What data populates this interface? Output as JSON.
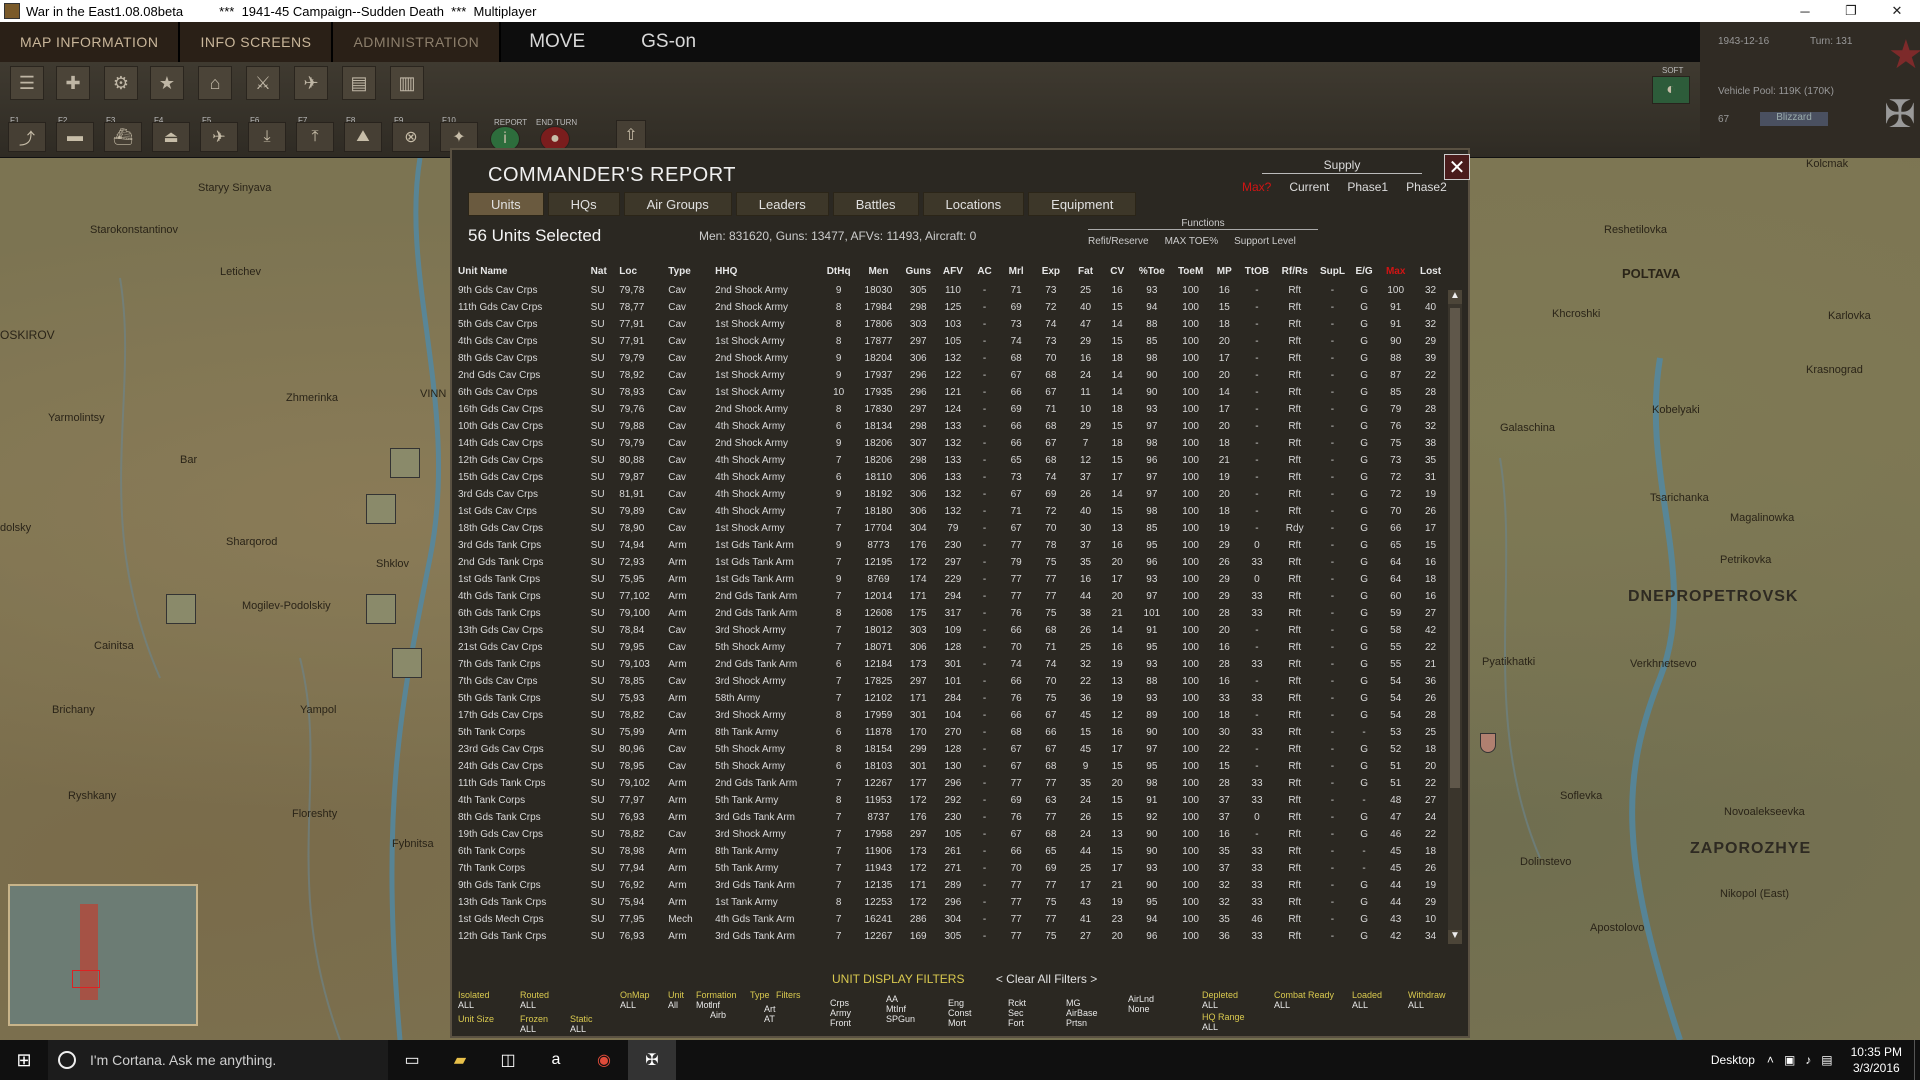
{
  "window": {
    "title": "War in the East1.08.08beta          ***  1941-45 Campaign--Sudden Death  ***  Multiplayer",
    "min": "─",
    "restore": "❐",
    "close": "✕"
  },
  "menubar": {
    "tabs": [
      "MAP INFORMATION",
      "INFO SCREENS",
      "ADMINISTRATION"
    ],
    "mode": "MOVE",
    "gs": "GS-on"
  },
  "toolbar": {
    "fkeys": [
      "F1",
      "F2",
      "F3",
      "F4",
      "F5",
      "F6",
      "F7",
      "F8",
      "F9",
      "F10"
    ],
    "report_label": "REPORT",
    "end_turn_label": "END TURN"
  },
  "infopanel": {
    "date": "1943-12-16",
    "turn": "Turn: 131",
    "vehicle_pool": "Vehicle Pool: 119K (170K)",
    "value67": "67",
    "weather": "Blizzard",
    "soft": "SOFT"
  },
  "map": {
    "towns": [
      {
        "name": "Staryy Sinyava"
      },
      {
        "name": "Starokonstantinov"
      },
      {
        "name": "Letichev"
      },
      {
        "name": "Zhmerinka"
      },
      {
        "name": "Yarmolintsy"
      },
      {
        "name": "Bar"
      },
      {
        "name": "Sharqorod"
      },
      {
        "name": "Shklov"
      },
      {
        "name": "Mogilev-Podolskiy"
      },
      {
        "name": "Cainitsa"
      },
      {
        "name": "Brichany"
      },
      {
        "name": "Yampol"
      },
      {
        "name": "Ryshkany"
      },
      {
        "name": "Floreshty"
      },
      {
        "name": "Fybnitsa"
      },
      {
        "name": "OSKIROV"
      },
      {
        "name": "dolsky"
      },
      {
        "name": "VINN"
      },
      {
        "name": "Kolcmak"
      },
      {
        "name": "Reshetilovka"
      },
      {
        "name": "POLTAVA"
      },
      {
        "name": "Khcroshki"
      },
      {
        "name": "Karlovka"
      },
      {
        "name": "Krasnograd"
      },
      {
        "name": "Kobelyaki"
      },
      {
        "name": "Galaschina"
      },
      {
        "name": "Tsarichanka"
      },
      {
        "name": "Magalinowka"
      },
      {
        "name": "Petrikovka"
      },
      {
        "name": "Pyatikhatki"
      },
      {
        "name": "Verkhnetsevo"
      },
      {
        "name": "Soflevka"
      },
      {
        "name": "Novoalekseevka"
      },
      {
        "name": "Dolinstevo"
      },
      {
        "name": "Nikopol (East)"
      },
      {
        "name": "Apostolovo"
      }
    ],
    "cities": [
      "DNEPROPETROVSK",
      "ZAPOROZHYE"
    ]
  },
  "report": {
    "title": "COMMANDER'S REPORT",
    "close": "✕",
    "supply": {
      "title": "Supply",
      "options": [
        "Max?",
        "Current",
        "Phase1",
        "Phase2"
      ]
    },
    "tabs": [
      "Units",
      "HQs",
      "Air Groups",
      "Leaders",
      "Battles",
      "Locations",
      "Equipment"
    ],
    "selected": "56 Units Selected",
    "summary": "Men: 831620, Guns: 13477, AFVs: 11493, Aircraft: 0",
    "functions": {
      "title": "Functions",
      "items": [
        "Refit/Reserve",
        "MAX TOE%",
        "Support Level"
      ]
    },
    "columns": [
      "Unit Name",
      "Nat",
      "Loc",
      "Type",
      "HHQ",
      "DtHq",
      "Men",
      "Guns",
      "AFV",
      "AC",
      "Mrl",
      "Exp",
      "Fat",
      "CV",
      "%Toe",
      "ToeM",
      "MP",
      "TtOB",
      "Rf/Rs",
      "SupL",
      "E/G",
      "Max",
      "Lost"
    ],
    "rows": [
      [
        "9th Gds Cav Crps",
        "SU",
        "79,78",
        "Cav",
        "2nd Shock Army",
        "9",
        "18030",
        "305",
        "110",
        "-",
        "71",
        "73",
        "25",
        "16",
        "93",
        "100",
        "16",
        "-",
        "Rft",
        "-",
        "G",
        "100",
        "32"
      ],
      [
        "11th Gds Cav Crps",
        "SU",
        "78,77",
        "Cav",
        "2nd Shock Army",
        "8",
        "17984",
        "298",
        "125",
        "-",
        "69",
        "72",
        "40",
        "15",
        "94",
        "100",
        "15",
        "-",
        "Rft",
        "-",
        "G",
        "91",
        "40"
      ],
      [
        "5th Gds Cav Crps",
        "SU",
        "77,91",
        "Cav",
        "1st Shock Army",
        "8",
        "17806",
        "303",
        "103",
        "-",
        "73",
        "74",
        "47",
        "14",
        "88",
        "100",
        "18",
        "-",
        "Rft",
        "-",
        "G",
        "91",
        "32"
      ],
      [
        "4th Gds Cav Crps",
        "SU",
        "77,91",
        "Cav",
        "1st Shock Army",
        "8",
        "17877",
        "297",
        "105",
        "-",
        "74",
        "73",
        "29",
        "15",
        "85",
        "100",
        "20",
        "-",
        "Rft",
        "-",
        "G",
        "90",
        "29"
      ],
      [
        "8th Gds Cav Crps",
        "SU",
        "79,79",
        "Cav",
        "2nd Shock Army",
        "9",
        "18204",
        "306",
        "132",
        "-",
        "68",
        "70",
        "16",
        "18",
        "98",
        "100",
        "17",
        "-",
        "Rft",
        "-",
        "G",
        "88",
        "39"
      ],
      [
        "2nd Gds Cav Crps",
        "SU",
        "78,92",
        "Cav",
        "1st Shock Army",
        "9",
        "17937",
        "296",
        "122",
        "-",
        "67",
        "68",
        "24",
        "14",
        "90",
        "100",
        "20",
        "-",
        "Rft",
        "-",
        "G",
        "87",
        "22"
      ],
      [
        "6th Gds Cav Crps",
        "SU",
        "78,93",
        "Cav",
        "1st Shock Army",
        "10",
        "17935",
        "296",
        "121",
        "-",
        "66",
        "67",
        "11",
        "14",
        "90",
        "100",
        "14",
        "-",
        "Rft",
        "-",
        "G",
        "85",
        "28"
      ],
      [
        "16th Gds Cav Crps",
        "SU",
        "79,76",
        "Cav",
        "2nd Shock Army",
        "8",
        "17830",
        "297",
        "124",
        "-",
        "69",
        "71",
        "10",
        "18",
        "93",
        "100",
        "17",
        "-",
        "Rft",
        "-",
        "G",
        "79",
        "28"
      ],
      [
        "10th Gds Cav Crps",
        "SU",
        "79,88",
        "Cav",
        "4th Shock Army",
        "6",
        "18134",
        "298",
        "133",
        "-",
        "66",
        "68",
        "29",
        "15",
        "97",
        "100",
        "20",
        "-",
        "Rft",
        "-",
        "G",
        "76",
        "32"
      ],
      [
        "14th Gds Cav Crps",
        "SU",
        "79,79",
        "Cav",
        "2nd Shock Army",
        "9",
        "18206",
        "307",
        "132",
        "-",
        "66",
        "67",
        "7",
        "18",
        "98",
        "100",
        "18",
        "-",
        "Rft",
        "-",
        "G",
        "75",
        "38"
      ],
      [
        "12th Gds Cav Crps",
        "SU",
        "80,88",
        "Cav",
        "4th Shock Army",
        "7",
        "18206",
        "298",
        "133",
        "-",
        "65",
        "68",
        "12",
        "15",
        "96",
        "100",
        "21",
        "-",
        "Rft",
        "-",
        "G",
        "73",
        "35"
      ],
      [
        "15th Gds Cav Crps",
        "SU",
        "79,87",
        "Cav",
        "4th Shock Army",
        "6",
        "18110",
        "306",
        "133",
        "-",
        "73",
        "74",
        "37",
        "17",
        "97",
        "100",
        "19",
        "-",
        "Rft",
        "-",
        "G",
        "72",
        "31"
      ],
      [
        "3rd Gds Cav Crps",
        "SU",
        "81,91",
        "Cav",
        "4th Shock Army",
        "9",
        "18192",
        "306",
        "132",
        "-",
        "67",
        "69",
        "26",
        "14",
        "97",
        "100",
        "20",
        "-",
        "Rft",
        "-",
        "G",
        "72",
        "19"
      ],
      [
        "1st Gds Cav Crps",
        "SU",
        "79,89",
        "Cav",
        "4th Shock Army",
        "7",
        "18180",
        "306",
        "132",
        "-",
        "71",
        "72",
        "40",
        "15",
        "98",
        "100",
        "18",
        "-",
        "Rft",
        "-",
        "G",
        "70",
        "26"
      ],
      [
        "18th Gds Cav Crps",
        "SU",
        "78,90",
        "Cav",
        "1st Shock Army",
        "7",
        "17704",
        "304",
        "79",
        "-",
        "67",
        "70",
        "30",
        "13",
        "85",
        "100",
        "19",
        "-",
        "Rdy",
        "-",
        "G",
        "66",
        "17"
      ],
      [
        "3rd Gds Tank Crps",
        "SU",
        "74,94",
        "Arm",
        "1st Gds Tank Arm",
        "9",
        "8773",
        "176",
        "230",
        "-",
        "77",
        "78",
        "37",
        "16",
        "95",
        "100",
        "29",
        "0",
        "Rft",
        "-",
        "G",
        "65",
        "15"
      ],
      [
        "2nd Gds Tank Crps",
        "SU",
        "72,93",
        "Arm",
        "1st Gds Tank Arm",
        "7",
        "12195",
        "172",
        "297",
        "-",
        "79",
        "75",
        "35",
        "20",
        "96",
        "100",
        "26",
        "33",
        "Rft",
        "-",
        "G",
        "64",
        "16"
      ],
      [
        "1st Gds Tank Crps",
        "SU",
        "75,95",
        "Arm",
        "1st Gds Tank Arm",
        "9",
        "8769",
        "174",
        "229",
        "-",
        "77",
        "77",
        "16",
        "17",
        "93",
        "100",
        "29",
        "0",
        "Rft",
        "-",
        "G",
        "64",
        "18"
      ],
      [
        "4th Gds Tank Crps",
        "SU",
        "77,102",
        "Arm",
        "2nd Gds Tank Arm",
        "7",
        "12014",
        "171",
        "294",
        "-",
        "77",
        "77",
        "44",
        "20",
        "97",
        "100",
        "29",
        "33",
        "Rft",
        "-",
        "G",
        "60",
        "16"
      ],
      [
        "6th Gds Tank Crps",
        "SU",
        "79,100",
        "Arm",
        "2nd Gds Tank Arm",
        "8",
        "12608",
        "175",
        "317",
        "-",
        "76",
        "75",
        "38",
        "21",
        "101",
        "100",
        "28",
        "33",
        "Rft",
        "-",
        "G",
        "59",
        "27"
      ],
      [
        "13th Gds Cav Crps",
        "SU",
        "78,84",
        "Cav",
        "3rd Shock Army",
        "7",
        "18012",
        "303",
        "109",
        "-",
        "66",
        "68",
        "26",
        "14",
        "91",
        "100",
        "20",
        "-",
        "Rft",
        "-",
        "G",
        "58",
        "42"
      ],
      [
        "21st Gds Cav Crps",
        "SU",
        "79,95",
        "Cav",
        "5th Shock Army",
        "7",
        "18071",
        "306",
        "128",
        "-",
        "70",
        "71",
        "25",
        "16",
        "95",
        "100",
        "16",
        "-",
        "Rft",
        "-",
        "G",
        "55",
        "22"
      ],
      [
        "7th Gds Tank Crps",
        "SU",
        "79,103",
        "Arm",
        "2nd Gds Tank Arm",
        "6",
        "12184",
        "173",
        "301",
        "-",
        "74",
        "74",
        "32",
        "19",
        "93",
        "100",
        "28",
        "33",
        "Rft",
        "-",
        "G",
        "55",
        "21"
      ],
      [
        "7th Gds Cav Crps",
        "SU",
        "78,85",
        "Cav",
        "3rd Shock Army",
        "7",
        "17825",
        "297",
        "101",
        "-",
        "66",
        "70",
        "22",
        "13",
        "88",
        "100",
        "16",
        "-",
        "Rft",
        "-",
        "G",
        "54",
        "36"
      ],
      [
        "5th Gds Tank Crps",
        "SU",
        "75,93",
        "Arm",
        "58th Army",
        "7",
        "12102",
        "171",
        "284",
        "-",
        "76",
        "75",
        "36",
        "19",
        "93",
        "100",
        "33",
        "33",
        "Rft",
        "-",
        "G",
        "54",
        "26"
      ],
      [
        "17th Gds Cav Crps",
        "SU",
        "78,82",
        "Cav",
        "3rd Shock Army",
        "8",
        "17959",
        "301",
        "104",
        "-",
        "66",
        "67",
        "45",
        "12",
        "89",
        "100",
        "18",
        "-",
        "Rft",
        "-",
        "G",
        "54",
        "28"
      ],
      [
        "5th Tank Corps",
        "SU",
        "75,99",
        "Arm",
        "8th Tank Army",
        "6",
        "11878",
        "170",
        "270",
        "-",
        "68",
        "66",
        "15",
        "16",
        "90",
        "100",
        "30",
        "33",
        "Rft",
        "-",
        "-",
        "53",
        "25"
      ],
      [
        "23rd Gds Cav Crps",
        "SU",
        "80,96",
        "Cav",
        "5th Shock Army",
        "8",
        "18154",
        "299",
        "128",
        "-",
        "67",
        "67",
        "45",
        "17",
        "97",
        "100",
        "22",
        "-",
        "Rft",
        "-",
        "G",
        "52",
        "18"
      ],
      [
        "24th Gds Cav Crps",
        "SU",
        "78,95",
        "Cav",
        "5th Shock Army",
        "6",
        "18103",
        "301",
        "130",
        "-",
        "67",
        "68",
        "9",
        "15",
        "95",
        "100",
        "15",
        "-",
        "Rft",
        "-",
        "G",
        "51",
        "20"
      ],
      [
        "11th Gds Tank Crps",
        "SU",
        "79,102",
        "Arm",
        "2nd Gds Tank Arm",
        "7",
        "12267",
        "177",
        "296",
        "-",
        "77",
        "77",
        "35",
        "20",
        "98",
        "100",
        "28",
        "33",
        "Rft",
        "-",
        "G",
        "51",
        "22"
      ],
      [
        "4th Tank Corps",
        "SU",
        "77,97",
        "Arm",
        "5th Tank Army",
        "8",
        "11953",
        "172",
        "292",
        "-",
        "69",
        "63",
        "24",
        "15",
        "91",
        "100",
        "37",
        "33",
        "Rft",
        "-",
        "-",
        "48",
        "27"
      ],
      [
        "8th Gds Tank Crps",
        "SU",
        "76,93",
        "Arm",
        "3rd Gds Tank Arm",
        "7",
        "8737",
        "176",
        "230",
        "-",
        "76",
        "77",
        "26",
        "15",
        "92",
        "100",
        "37",
        "0",
        "Rft",
        "-",
        "G",
        "47",
        "24"
      ],
      [
        "19th Gds Cav Crps",
        "SU",
        "78,82",
        "Cav",
        "3rd Shock Army",
        "7",
        "17958",
        "297",
        "105",
        "-",
        "67",
        "68",
        "24",
        "13",
        "90",
        "100",
        "16",
        "-",
        "Rft",
        "-",
        "G",
        "46",
        "22"
      ],
      [
        "6th Tank Corps",
        "SU",
        "78,98",
        "Arm",
        "8th Tank Army",
        "7",
        "11906",
        "173",
        "261",
        "-",
        "66",
        "65",
        "44",
        "15",
        "90",
        "100",
        "35",
        "33",
        "Rft",
        "-",
        "-",
        "45",
        "18"
      ],
      [
        "7th Tank Corps",
        "SU",
        "77,94",
        "Arm",
        "5th Tank Army",
        "7",
        "11943",
        "172",
        "271",
        "-",
        "70",
        "69",
        "25",
        "17",
        "93",
        "100",
        "37",
        "33",
        "Rft",
        "-",
        "-",
        "45",
        "26"
      ],
      [
        "9th Gds Tank Crps",
        "SU",
        "76,92",
        "Arm",
        "3rd Gds Tank Arm",
        "7",
        "12135",
        "171",
        "289",
        "-",
        "77",
        "77",
        "17",
        "21",
        "90",
        "100",
        "32",
        "33",
        "Rft",
        "-",
        "G",
        "44",
        "19"
      ],
      [
        "13th Gds Tank Crps",
        "SU",
        "75,94",
        "Arm",
        "1st Tank Army",
        "8",
        "12253",
        "172",
        "296",
        "-",
        "77",
        "75",
        "43",
        "19",
        "95",
        "100",
        "32",
        "33",
        "Rft",
        "-",
        "G",
        "44",
        "29"
      ],
      [
        "1st Gds Mech Crps",
        "SU",
        "77,95",
        "Mech",
        "4th Gds Tank Arm",
        "7",
        "16241",
        "286",
        "304",
        "-",
        "77",
        "77",
        "41",
        "23",
        "94",
        "100",
        "35",
        "46",
        "Rft",
        "-",
        "G",
        "43",
        "10"
      ],
      [
        "12th Gds Tank Crps",
        "SU",
        "76,93",
        "Arm",
        "3rd Gds Tank Arm",
        "7",
        "12267",
        "169",
        "305",
        "-",
        "77",
        "75",
        "27",
        "20",
        "96",
        "100",
        "36",
        "33",
        "Rft",
        "-",
        "G",
        "42",
        "34"
      ]
    ],
    "filters_title": "UNIT DISPLAY FILTERS",
    "clear_filters": "< Clear All Filters >",
    "filters": [
      {
        "label": "Isolated",
        "value": "ALL"
      },
      {
        "label": "Routed",
        "value": "ALL"
      },
      {
        "label": "OnMap",
        "value": "ALL"
      },
      {
        "label": "Unit",
        "value": "All"
      },
      {
        "label": "Formation",
        "value": "Mot"
      },
      {
        "label": "Type",
        "value": ""
      },
      {
        "label": "Filters",
        "value": ""
      },
      {
        "label": "Unit Size",
        "value": ""
      },
      {
        "label": "Frozen",
        "value": "ALL"
      },
      {
        "label": "Static",
        "value": "ALL"
      },
      {
        "label": "Depleted",
        "value": "ALL"
      },
      {
        "label": "Combat Ready",
        "value": "ALL"
      },
      {
        "label": "Loaded",
        "value": "ALL"
      },
      {
        "label": "Withdraw",
        "value": "ALL"
      },
      {
        "label": "HQ Range",
        "value": "ALL"
      }
    ],
    "filter_types": [
      "Inf",
      "Airb",
      "Art",
      "AT",
      "Crps",
      "Army",
      "Front",
      "AA",
      "MtInf",
      "SPGun",
      "Eng",
      "Const",
      "Mort",
      "Rckt",
      "Sec",
      "Fort",
      "MG",
      "AirBase",
      "Prtsn",
      "AirLnd",
      "None",
      "Sec"
    ]
  },
  "taskbar": {
    "cortana": "I'm Cortana. Ask me anything.",
    "desktop": "Desktop",
    "time": "10:35 PM",
    "date": "3/3/2016"
  }
}
